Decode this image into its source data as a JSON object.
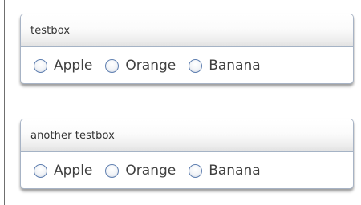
{
  "fieldsets": [
    {
      "legend": "testbox",
      "options": [
        {
          "label": "Apple",
          "selected": false
        },
        {
          "label": "Orange",
          "selected": false
        },
        {
          "label": "Banana",
          "selected": false
        }
      ]
    },
    {
      "legend": "another testbox",
      "options": [
        {
          "label": "Apple",
          "selected": false
        },
        {
          "label": "Orange",
          "selected": false
        },
        {
          "label": "Banana",
          "selected": false
        }
      ]
    }
  ],
  "colors": {
    "box_border": "#a7b3c5",
    "legend_text": "#333333",
    "option_text": "#3f3f3f",
    "radio_border": "#5f7fb0"
  }
}
